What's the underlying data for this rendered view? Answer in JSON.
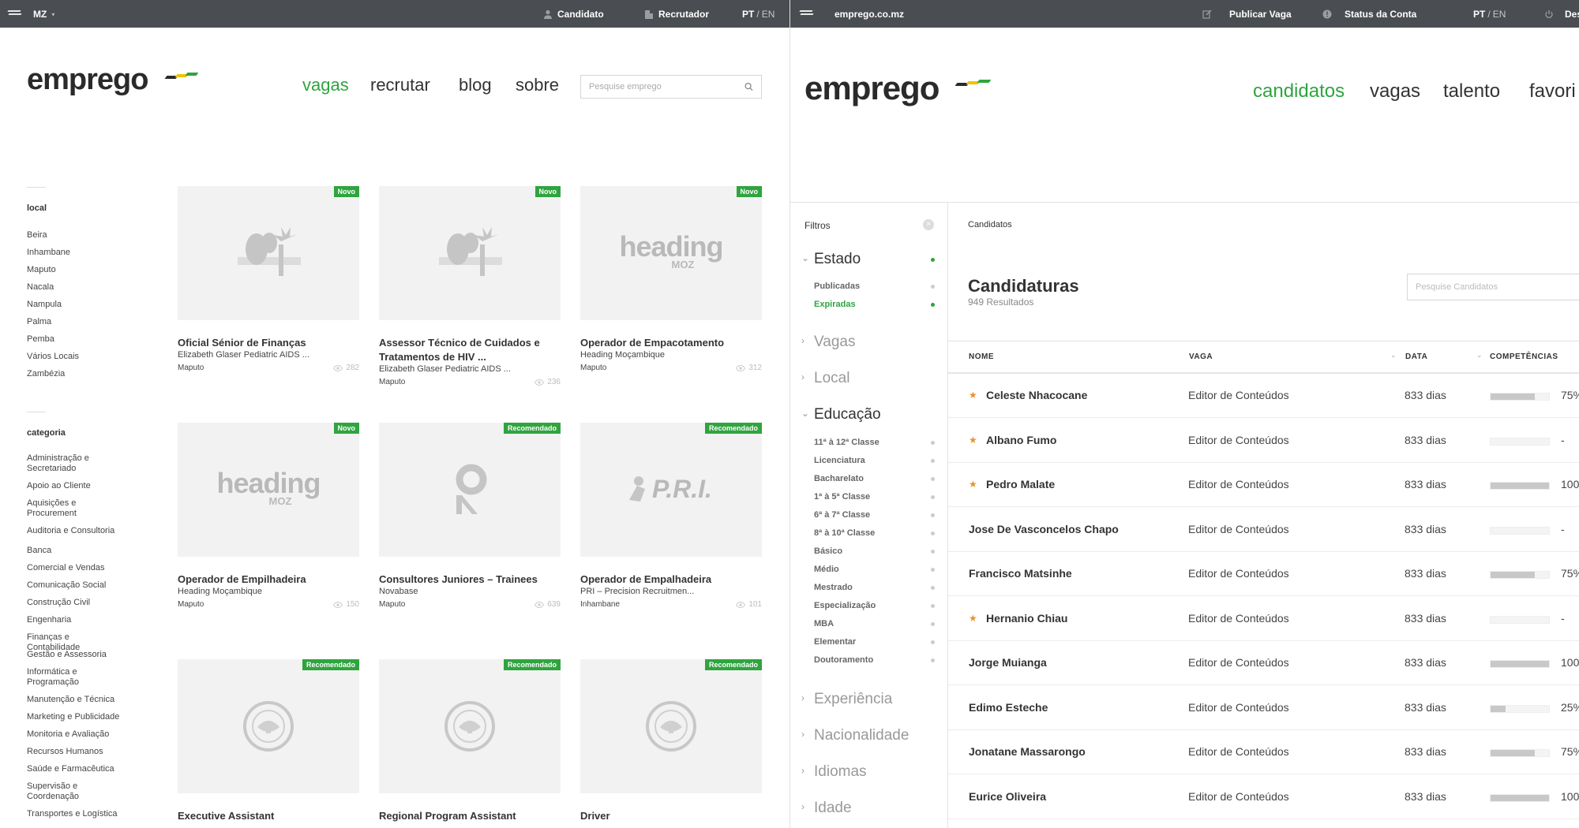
{
  "left": {
    "topbar": {
      "country": "MZ",
      "candidato": "Candidato",
      "recrutador": "Recrutador",
      "lang_pt": "PT",
      "lang_sep": "/",
      "lang_en": "EN"
    },
    "brand": "emprego",
    "nav": {
      "vagas": "vagas",
      "recrutar": "recrutar",
      "blog": "blog",
      "sobre": "sobre"
    },
    "search": {
      "placeholder": "Pesquise emprego"
    },
    "sidebar": {
      "local_heading": "local",
      "locals": [
        "Beira",
        "Inhambane",
        "Maputo",
        "Nacala",
        "Nampula",
        "Palma",
        "Pemba",
        "Vários Locais",
        "Zambézia"
      ],
      "categoria_heading": "categoria",
      "categorias": [
        "Administração e Secretariado",
        "Apoio ao Cliente",
        "Aquisições e Procurement",
        "Auditoria e Consultoria",
        "Banca",
        "Comercial e Vendas",
        "Comunicação Social",
        "Construção Civil",
        "Engenharia",
        "Finanças e Contabilidade",
        "Gestão e Assessoria",
        "Informática e Programação",
        "Manutenção e Técnica",
        "Marketing e Publicidade",
        "Monitoria e Avaliação",
        "Recursos Humanos",
        "Saúde e Farmacêutica",
        "Supervisão e Coordenação",
        "Transportes e Logística"
      ]
    },
    "jobs": [
      {
        "badge": "Novo",
        "logo": "egpaf-logo-icon",
        "title": "Oficial Sénior de Finanças",
        "company": "Elizabeth Glaser Pediatric AIDS ...",
        "location": "Maputo",
        "views": "282"
      },
      {
        "badge": "Novo",
        "logo": "egpaf-logo-icon",
        "title": "Assessor Técnico de Cuidados e Tratamentos de HIV ...",
        "company": "Elizabeth Glaser Pediatric AIDS ...",
        "location": "Maputo",
        "views": "236"
      },
      {
        "badge": "Novo",
        "logo": "heading-moz-logo-icon",
        "logo_word": "heading",
        "logo_sub": "MOZ",
        "title": "Operador de Empacotamento",
        "company": "Heading Moçambique",
        "location": "Maputo",
        "views": "312"
      },
      {
        "badge": "Novo",
        "logo": "heading-moz-logo-icon",
        "logo_word": "heading",
        "logo_sub": "MOZ",
        "title": "Operador de Empilhadeira",
        "company": "Heading Moçambique",
        "location": "Maputo",
        "views": "150"
      },
      {
        "badge": "Recomendado",
        "logo": "novabase-logo-icon",
        "title": "Consultores Juniores – Trainees",
        "company": "Novabase",
        "location": "Maputo",
        "views": "639"
      },
      {
        "badge": "Recomendado",
        "logo": "pri-logo-icon",
        "logo_word": "P.R.I.",
        "title": "Operador de Empalhadeira",
        "company": "PRI – Precision Recruitmen...",
        "location": "Inhambane",
        "views": "101"
      },
      {
        "badge": "Recomendado",
        "logo": "us-embassy-seal-icon",
        "title": "Executive Assistant"
      },
      {
        "badge": "Recomendado",
        "logo": "us-embassy-seal-icon",
        "title": "Regional Program Assistant"
      },
      {
        "badge": "Recomendado",
        "logo": "us-embassy-seal-icon",
        "title": "Driver"
      }
    ]
  },
  "right": {
    "topbar": {
      "site": "emprego.co.mz",
      "publicar": "Publicar Vaga",
      "status": "Status da Conta",
      "lang_pt": "PT",
      "lang_sep": "/",
      "lang_en": "EN",
      "logout": "Des"
    },
    "brand": "emprego",
    "nav": {
      "candidatos": "candidatos",
      "vagas": "vagas",
      "talento": "talento",
      "favoritos": "favori"
    },
    "filters": {
      "title": "Filtros",
      "estado": "Estado",
      "estado_items": [
        "Publicadas",
        "Expiradas"
      ],
      "vagas": "Vagas",
      "local": "Local",
      "educacao": "Educação",
      "educacao_items": [
        "11ª à 12ª Classe",
        "Licenciatura",
        "Bacharelato",
        "1ª à 5ª Classe",
        "6ª à 7ª Classe",
        "8ª à 10ª Classe",
        "Básico",
        "Médio",
        "Mestrado",
        "Especialização",
        "MBA",
        "Elementar",
        "Doutoramento"
      ],
      "experiencia": "Experiência",
      "nacionalidade": "Nacionalidade",
      "idiomas": "Idiomas",
      "idade": "Idade"
    },
    "breadcrumb": "Candidatos",
    "title": "Candidaturas",
    "count": "949 Resultados",
    "search_placeholder": "Pesquise Candidatos",
    "columns": {
      "nome": "NOME",
      "vaga": "VAGA",
      "data": "DATA",
      "competencias": "COMPETÊNCIAS"
    },
    "rows": [
      {
        "star": true,
        "name": "Celeste Nhacocane",
        "vaga": "Editor de Conteúdos",
        "data": "833 dias",
        "competencia": 0.75,
        "pct": "75%"
      },
      {
        "star": true,
        "name": "Albano Fumo",
        "vaga": "Editor de Conteúdos",
        "data": "833 dias",
        "competencia": 0,
        "pct": "-"
      },
      {
        "star": true,
        "name": "Pedro Malate",
        "vaga": "Editor de Conteúdos",
        "data": "833 dias",
        "competencia": 1.0,
        "pct": "100"
      },
      {
        "star": false,
        "name": "Jose De Vasconcelos Chapo",
        "vaga": "Editor de Conteúdos",
        "data": "833 dias",
        "competencia": 0,
        "pct": "-"
      },
      {
        "star": false,
        "name": "Francisco Matsinhe",
        "vaga": "Editor de Conteúdos",
        "data": "833 dias",
        "competencia": 0.75,
        "pct": "75%"
      },
      {
        "star": true,
        "name": "Hernanio Chiau",
        "vaga": "Editor de Conteúdos",
        "data": "833 dias",
        "competencia": 0,
        "pct": "-"
      },
      {
        "star": false,
        "name": "Jorge Muianga",
        "vaga": "Editor de Conteúdos",
        "data": "833 dias",
        "competencia": 1.0,
        "pct": "100"
      },
      {
        "star": false,
        "name": "Edimo Esteche",
        "vaga": "Editor de Conteúdos",
        "data": "833 dias",
        "competencia": 0.25,
        "pct": "25%"
      },
      {
        "star": false,
        "name": "Jonatane Massarongo",
        "vaga": "Editor de Conteúdos",
        "data": "833 dias",
        "competencia": 0.75,
        "pct": "75%"
      },
      {
        "star": false,
        "name": "Eurice Oliveira",
        "vaga": "Editor de Conteúdos",
        "data": "833 dias",
        "competencia": 1.0,
        "pct": "100"
      }
    ]
  },
  "colors": {
    "topbar": "#4a4d52",
    "accent_green": "#2fa43f",
    "star_orange": "#e8922b",
    "stripe_green": "#2fa43f",
    "stripe_yellow": "#f2c200",
    "stripe_dark": "#2a2a2a"
  }
}
